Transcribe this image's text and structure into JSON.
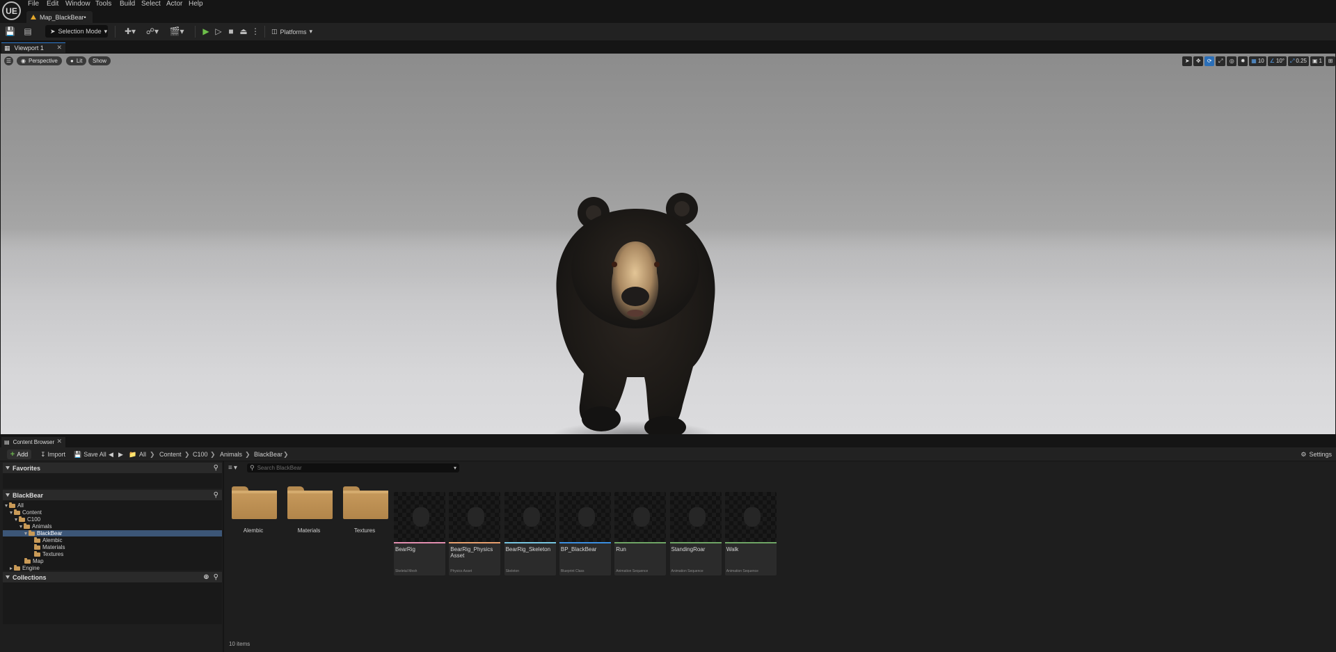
{
  "app": {
    "logo": "UE",
    "menu": [
      "File",
      "Edit",
      "Window",
      "Tools",
      "Build",
      "Select",
      "Actor",
      "Help"
    ],
    "document_tab": "Map_BlackBear•"
  },
  "toolbar": {
    "selection_mode": "Selection Mode",
    "platforms": "Platforms"
  },
  "viewport": {
    "tab_label": "Viewport 1",
    "perspective": "Perspective",
    "lit": "Lit",
    "show": "Show",
    "grid_snap": "10",
    "rotation_snap": "10°",
    "scale_snap": "0.25",
    "camera_speed": "1"
  },
  "content_browser": {
    "tab_label": "Content Browser",
    "add": "Add",
    "import": "Import",
    "save_all": "Save All",
    "breadcrumb": [
      "All",
      "Content",
      "C100",
      "Animals",
      "BlackBear"
    ],
    "settings": "Settings",
    "favorites": "Favorites",
    "path_section": "BlackBear",
    "collections": "Collections",
    "tree": [
      {
        "label": "All",
        "depth": 0,
        "expanded": true,
        "selected": false
      },
      {
        "label": "Content",
        "depth": 1,
        "expanded": true,
        "selected": false
      },
      {
        "label": "C100",
        "depth": 2,
        "expanded": true,
        "selected": false
      },
      {
        "label": "Animals",
        "depth": 3,
        "expanded": true,
        "selected": false
      },
      {
        "label": "BlackBear",
        "depth": 4,
        "expanded": true,
        "selected": true
      },
      {
        "label": "Alembic",
        "depth": 5,
        "expanded": null,
        "selected": false
      },
      {
        "label": "Materials",
        "depth": 5,
        "expanded": null,
        "selected": false
      },
      {
        "label": "Textures",
        "depth": 5,
        "expanded": null,
        "selected": false
      },
      {
        "label": "Map",
        "depth": 3,
        "expanded": null,
        "selected": false
      },
      {
        "label": "Engine",
        "depth": 1,
        "expanded": false,
        "selected": false
      }
    ],
    "search_placeholder": "Search BlackBear",
    "folders": [
      "Alembic",
      "Materials",
      "Textures"
    ],
    "assets": [
      {
        "name": "BearRig",
        "type": "Skeletal Mesh",
        "color": "#e38fb0"
      },
      {
        "name": "BearRig_Physics\nAsset",
        "type": "Physics Asset",
        "color": "#e8a06f"
      },
      {
        "name": "BearRig_Skeleton",
        "type": "Skeleton",
        "color": "#76c5e0"
      },
      {
        "name": "BP_BlackBear",
        "type": "Blueprint Class",
        "color": "#3b8fe0"
      },
      {
        "name": "Run",
        "type": "Animation Sequence",
        "color": "#6fa566"
      },
      {
        "name": "StandingRoar",
        "type": "Animation Sequence",
        "color": "#6fa566"
      },
      {
        "name": "Walk",
        "type": "Animation Sequence",
        "color": "#6fa566"
      }
    ],
    "items_count": "10 items"
  }
}
